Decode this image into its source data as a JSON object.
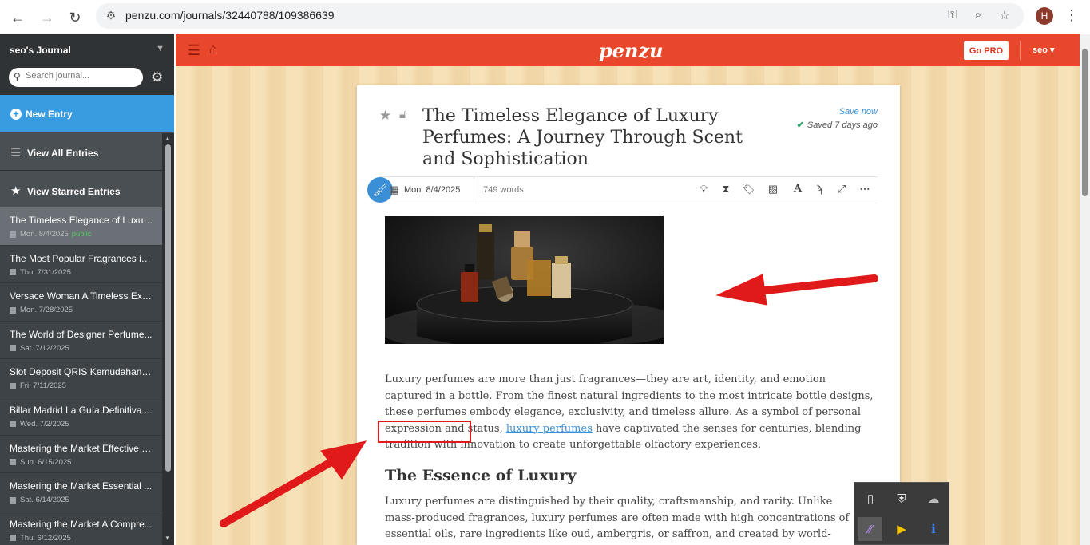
{
  "browser": {
    "url": "penzu.com/journals/32440788/109386639",
    "profile_initial": "H"
  },
  "header": {
    "logo": "penzu",
    "go_pro": "Go PRO",
    "user": "seo ▾"
  },
  "sidebar": {
    "journal_title": "seo's Journal",
    "search_placeholder": "Search journal...",
    "new_entry": "New Entry",
    "view_all": "View All Entries",
    "view_starred": "View Starred Entries",
    "entries": [
      {
        "title": "The Timeless Elegance of Luxury Perfumes",
        "date": "Mon. 8/4/2025",
        "status": "public"
      },
      {
        "title": "The Most Popular Fragrances in ...",
        "date": "Thu. 7/31/2025",
        "status": ""
      },
      {
        "title": "Versace Woman A Timeless Expr...",
        "date": "Mon. 7/28/2025",
        "status": ""
      },
      {
        "title": "The World of Designer Perfume...",
        "date": "Sat. 7/12/2025",
        "status": ""
      },
      {
        "title": "Slot Deposit QRIS Kemudahan T...",
        "date": "Fri. 7/11/2025",
        "status": ""
      },
      {
        "title": "Billar Madrid La Guía Definitiva ...",
        "date": "Wed. 7/2/2025",
        "status": ""
      },
      {
        "title": "Mastering the Market Effective S...",
        "date": "Sun. 6/15/2025",
        "status": ""
      },
      {
        "title": "Mastering the Market Essential ...",
        "date": "Sat. 6/14/2025",
        "status": ""
      },
      {
        "title": "Mastering the Market A Compre...",
        "date": "Thu. 6/12/2025",
        "status": ""
      }
    ]
  },
  "entry": {
    "title": "The Timeless Elegance of Luxury Perfumes: A Journey Through Scent and Sophistication",
    "save_now": "Save now",
    "saved": "Saved 7 days ago",
    "date": "Mon. 8/4/2025",
    "word_count": "749 words",
    "para1_before": "Luxury perfumes are more than just fragrances—they are art, identity, and emotion captured in a bottle. From the finest natural ingredients to the most intricate bottle designs, these perfumes embody elegance, exclusivity, and timeless allure. As a symbol of personal expression and status, ",
    "para1_link": "luxury perfumes",
    "para1_after": " have captivated the senses for centuries, blending tradition with innovation to create unforgettable olfactory experiences.",
    "heading2": "The Essence of Luxury",
    "para2": "Luxury perfumes are distinguished by their quality, craftsmanship, and rarity. Unlike mass-produced fragrances, luxury perfumes are often made with high concentrations of essential oils, rare ingredients like oud, ambergris, or saffron, and created by world-renowned perfumers."
  },
  "colors": {
    "brand_red": "#e8472b",
    "sidebar_bg": "#3e4347",
    "accent_blue": "#3a9ce0",
    "annotation_red": "#e01a1a"
  }
}
